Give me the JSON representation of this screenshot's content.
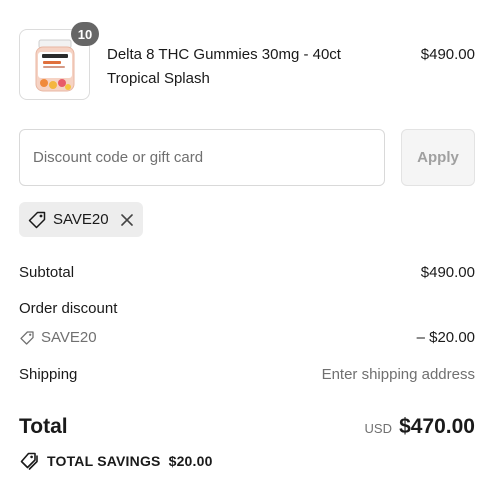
{
  "line_item": {
    "quantity": "10",
    "name": "Delta 8 THC Gummies 30mg - 40ct Tropical Splash",
    "price": "$490.00",
    "image_icon": "gummies-jar-icon"
  },
  "discount": {
    "placeholder": "Discount code or gift card",
    "value": "",
    "apply_label": "Apply",
    "applied_code": "SAVE20"
  },
  "summary": {
    "subtotal_label": "Subtotal",
    "subtotal_value": "$490.00",
    "order_discount_label": "Order discount",
    "discount_code": "SAVE20",
    "discount_value": "– $20.00",
    "shipping_label": "Shipping",
    "shipping_value": "Enter shipping address",
    "total_label": "Total",
    "total_currency": "USD",
    "total_value": "$470.00",
    "savings_label": "TOTAL SAVINGS",
    "savings_value": "$20.00"
  },
  "colors": {
    "badge": "#666666",
    "muted_text": "#707070",
    "chip_bg": "#ededed",
    "button_bg": "#f5f5f5"
  }
}
